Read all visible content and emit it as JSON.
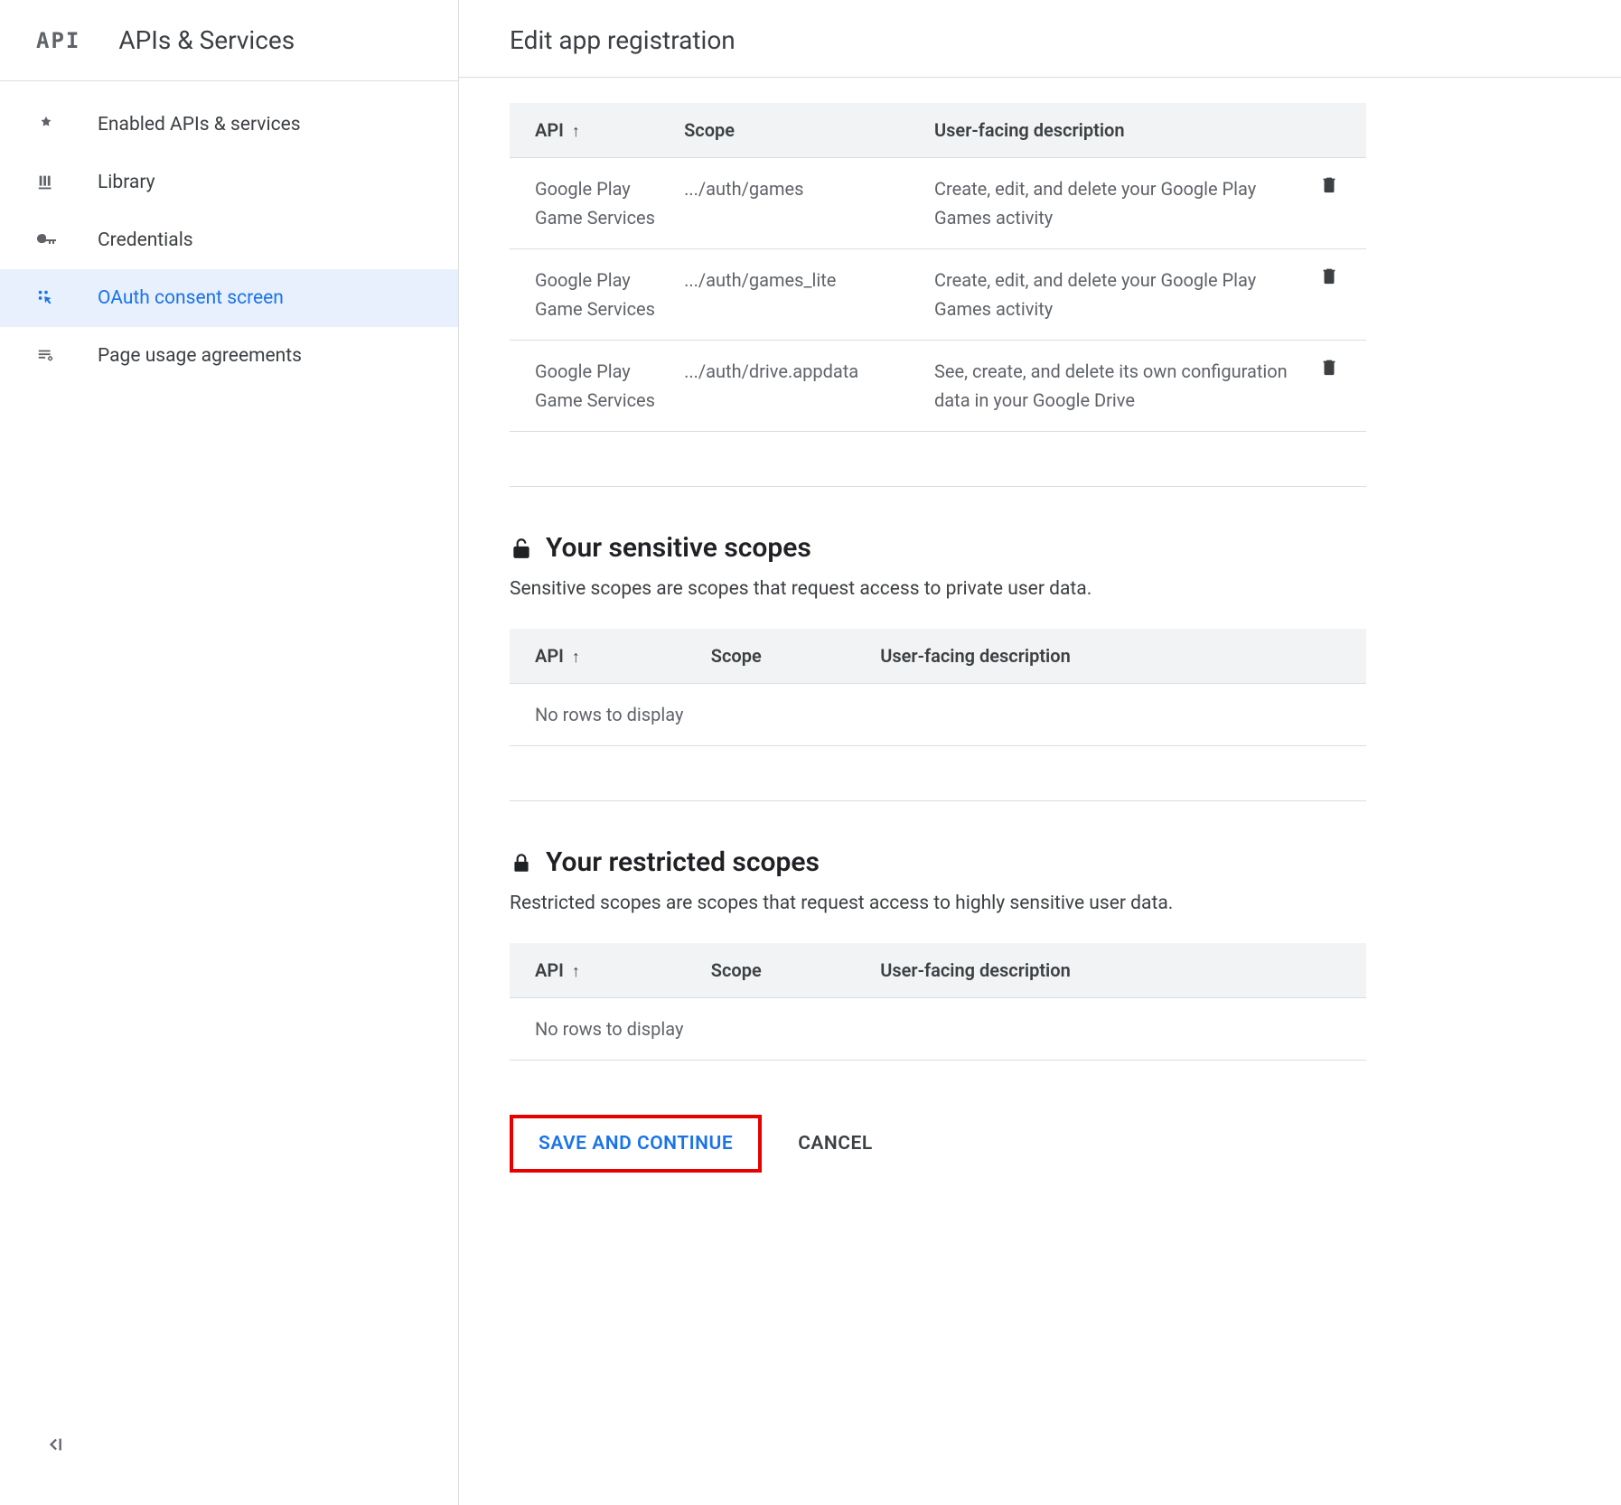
{
  "sidebar": {
    "logo": "API",
    "title": "APIs & Services",
    "items": [
      {
        "label": "Enabled APIs & services"
      },
      {
        "label": "Library"
      },
      {
        "label": "Credentials"
      },
      {
        "label": "OAuth consent screen"
      },
      {
        "label": "Page usage agreements"
      }
    ]
  },
  "main": {
    "title": "Edit app registration",
    "table_headers": {
      "api": "API",
      "scope": "Scope",
      "desc": "User-facing description"
    },
    "scopes": [
      {
        "api": "Google Play Game Services",
        "scope": ".../auth/games",
        "desc": "Create, edit, and delete your Google Play Games activity"
      },
      {
        "api": "Google Play Game Services",
        "scope": ".../auth/games_lite",
        "desc": "Create, edit, and delete your Google Play Games activity"
      },
      {
        "api": "Google Play Game Services",
        "scope": ".../auth/drive.appdata",
        "desc": "See, create, and delete its own configuration data in your Google Drive"
      }
    ],
    "sensitive": {
      "title": "Your sensitive scopes",
      "desc": "Sensitive scopes are scopes that request access to private user data.",
      "empty": "No rows to display"
    },
    "restricted": {
      "title": "Your restricted scopes",
      "desc": "Restricted scopes are scopes that request access to highly sensitive user data.",
      "empty": "No rows to display"
    },
    "buttons": {
      "save": "SAVE AND CONTINUE",
      "cancel": "CANCEL"
    }
  }
}
